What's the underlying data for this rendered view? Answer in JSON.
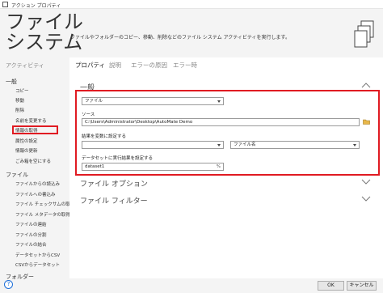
{
  "window": {
    "title": "アクション プロパティ"
  },
  "header": {
    "title_line1": "ファイル",
    "title_line2": "システム",
    "description": "ファイルやフォルダーのコピー、移動、削除などのファイル システム アクティビティを実行します。",
    "icon": "files-icon"
  },
  "sidebar": {
    "heading": "アクティビティ",
    "categories": [
      {
        "label": "一般",
        "items": [
          "コピー",
          "移動",
          "削除",
          "名前を変更する",
          "情報の取得",
          "属性の設定",
          "情報の更新",
          "ごみ箱を空にする"
        ]
      },
      {
        "label": "ファイル",
        "items": [
          "ファイルからの読込み",
          "ファイルへの書込み",
          "ファイル チェックサムの取得",
          "ファイル メタデータの取得",
          "ファイルの連結",
          "ファイルの分割",
          "ファイルの結合",
          "データセットからCSV",
          "CSVからデータセット"
        ]
      },
      {
        "label": "フォルダー",
        "items": []
      }
    ],
    "selected_item": "情報の取得"
  },
  "tabs": [
    "プロパティ",
    "説明",
    "エラーの原因",
    "エラー時"
  ],
  "active_tab": "プロパティ",
  "sections": {
    "general": "一般",
    "file_options": "ファイル オプション",
    "file_filter": "ファイル フィルター"
  },
  "form": {
    "type_value": "ファイル",
    "source_label": "ソース",
    "source_value": "C:\\Users\\Administrator\\Desktop\\AutoMate Demo",
    "result_var_label": "結果を変数に設定する",
    "result_var_value": "",
    "result_field_value": "ファイル名",
    "dataset_label": "データセットに実行結果を設定する",
    "dataset_value": "dataset1",
    "dataset_suffix": "%"
  },
  "buttons": {
    "ok": "OK",
    "cancel": "キャンセル"
  },
  "help": "?",
  "colors": {
    "highlight": "#e01b22",
    "header_bg": "#f4f4f4",
    "help_blue": "#1e6fd9"
  }
}
